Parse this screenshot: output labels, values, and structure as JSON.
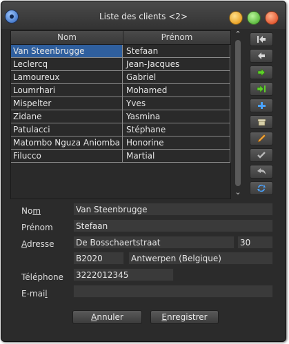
{
  "window": {
    "title": "Liste des clients <2>"
  },
  "table": {
    "columns": [
      "Nom",
      "Prénom"
    ],
    "rows": [
      {
        "nom": "Van Steenbrugge",
        "prenom": "Stefaan"
      },
      {
        "nom": "Leclercq",
        "prenom": "Jean-Jacques"
      },
      {
        "nom": "Lamoureux",
        "prenom": "Gabriel"
      },
      {
        "nom": "Loumrhari",
        "prenom": "Mohamed"
      },
      {
        "nom": "Mispelter",
        "prenom": "Yves"
      },
      {
        "nom": "Zidane",
        "prenom": "Yasmina"
      },
      {
        "nom": "Patulacci",
        "prenom": "Stéphane"
      },
      {
        "nom": "Matombo Nguza Aniomba",
        "prenom": "Honorine"
      },
      {
        "nom": "Filucco",
        "prenom": "Martial"
      }
    ]
  },
  "toolbar": {
    "icons": [
      "first-record-icon",
      "previous-record-icon",
      "next-record-icon",
      "last-record-icon",
      "add-record-icon",
      "delete-record-icon",
      "edit-record-icon",
      "confirm-icon",
      "undo-icon",
      "refresh-icon"
    ]
  },
  "form": {
    "nom_label_a": "No",
    "nom_label_b": "m",
    "nom_value": "Van Steenbrugge",
    "prenom_label": "Prénom",
    "prenom_value": "Stefaan",
    "adresse_label_a": "A",
    "adresse_label_b": "dresse",
    "street_value": "De Bosschaertstraat",
    "number_value": "30",
    "postal_value": "B2020",
    "city_value": "Antwerpen (Belgique)",
    "telephone_label": "Téléphone",
    "telephone_value": "3222012345",
    "email_label_a": "E-mai",
    "email_label_b": "l",
    "email_value": ""
  },
  "buttons": {
    "cancel_a": "A",
    "cancel_b": "nnuler",
    "save_a": "E",
    "save_b": "nregistrer"
  },
  "colors": {
    "selection": "#2f5f9e",
    "window_bg": "#2b2b2b"
  }
}
